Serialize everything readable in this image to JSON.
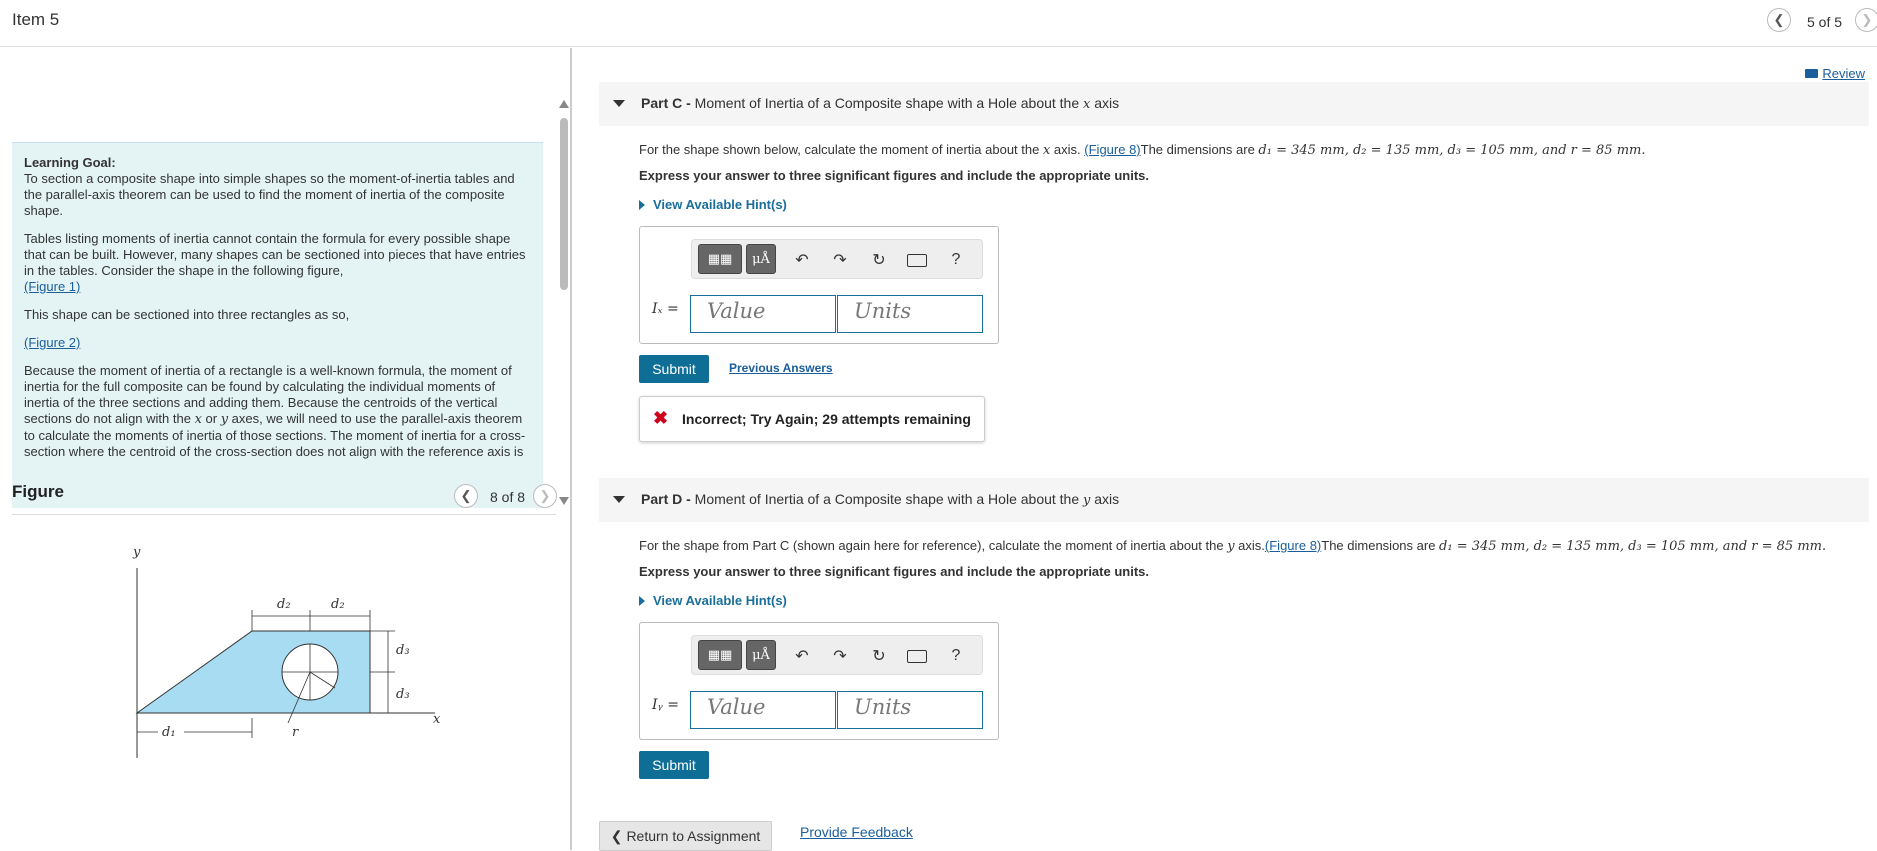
{
  "topbar": {
    "title": "Item 5",
    "prev_icon": "chevron-left-icon",
    "next_icon": "chevron-right-icon",
    "page_count": "5 of 5"
  },
  "left": {
    "goal_title": "Learning Goal:",
    "goal_text": "To section a composite shape into simple shapes so the moment-of-inertia tables and the parallel-axis theorem can be used to find the moment of inertia of the composite shape.",
    "tables_text": "Tables listing moments of inertia cannot contain the formula for every possible shape that can be built. However, many shapes can be sectioned into pieces that have entries in the tables. Consider the shape in the following figure,",
    "figure1_link": "(Figure 1)",
    "section_text": "This shape can be sectioned into three rectangles as so,",
    "figure2_link": "(Figure 2)",
    "because_part1": "Because the moment of inertia of a rectangle is a well-known formula, the moment of inertia for the full composite can be found by calculating the individual moments of inertia of the three sections and adding them. Because the centroids of the vertical sections do not align with the ",
    "because_x": "x",
    "because_or": " or ",
    "because_y": "y",
    "because_part2": " axes, we will need to use the parallel-axis theorem to calculate the moments of inertia of those sections. The moment of inertia for a cross-section where the centroid of the cross-section does not align with the reference axis is",
    "figure_header": "Figure",
    "figure_count": "8 of 8",
    "fig_labels": {
      "y": "y",
      "x": "x",
      "d1": "d₁",
      "d2a": "d₂",
      "d2b": "d₂",
      "d3a": "d₃",
      "d3b": "d₃",
      "r": "r"
    }
  },
  "right": {
    "review": "Review",
    "review_icon": "book-icon",
    "partC": {
      "label": "Part C -",
      "title": " Moment of Inertia of a Composite shape with a Hole about the ",
      "axis": "x",
      "axis_suffix": " axis",
      "prompt_a": "For the shape shown below, calculate the  moment of inertia about the ",
      "prompt_axis": "x",
      "prompt_b": " axis. ",
      "fig_link": "(Figure 8)",
      "prompt_c": "The dimensions are ",
      "dims": "d₁ = 345 mm, d₂ = 135 mm, d₃ = 105 mm, and r = 85 mm.",
      "instruction": "Express your answer to three significant figures and include the appropriate units.",
      "hint": "View Available Hint(s)",
      "eq_label": "Iₓ =",
      "value_placeholder": "Value",
      "units_placeholder": "Units",
      "submit": "Submit",
      "previous": "Previous Answers",
      "feedback": "Incorrect; Try Again; 29 attempts remaining"
    },
    "partD": {
      "label": "Part D -",
      "title": " Moment of Inertia of a Composite shape with a Hole about the ",
      "axis": "y",
      "axis_suffix": " axis",
      "prompt_a": "For the shape from Part C (shown again here for reference), calculate the  moment of inertia about the ",
      "prompt_axis": "y",
      "prompt_b": " axis.",
      "fig_link": "(Figure 8)",
      "prompt_c": "The dimensions are ",
      "dims": "d₁ = 345 mm, d₂ = 135 mm, d₃ = 105 mm, and r = 85 mm.",
      "instruction": "Express your answer to three significant figures and include the appropriate units.",
      "hint": "View Available Hint(s)",
      "eq_label": "Iᵧ =",
      "value_placeholder": "Value",
      "units_placeholder": "Units",
      "submit": "Submit"
    },
    "toolbar": {
      "templates_icon": "templates-icon",
      "symbols_label": "μÅ",
      "undo": "↶",
      "redo": "↷",
      "reset": "↻",
      "keyboard_icon": "keyboard-icon",
      "help": "?"
    },
    "return_label": "Return to Assignment",
    "provide_feedback": "Provide Feedback"
  },
  "colors": {
    "accent": "#0f6e96",
    "link": "#1a5e9c",
    "goal_bg": "#e4f4f5",
    "shape_fill": "#a8dcf3",
    "error": "#d0021b"
  }
}
